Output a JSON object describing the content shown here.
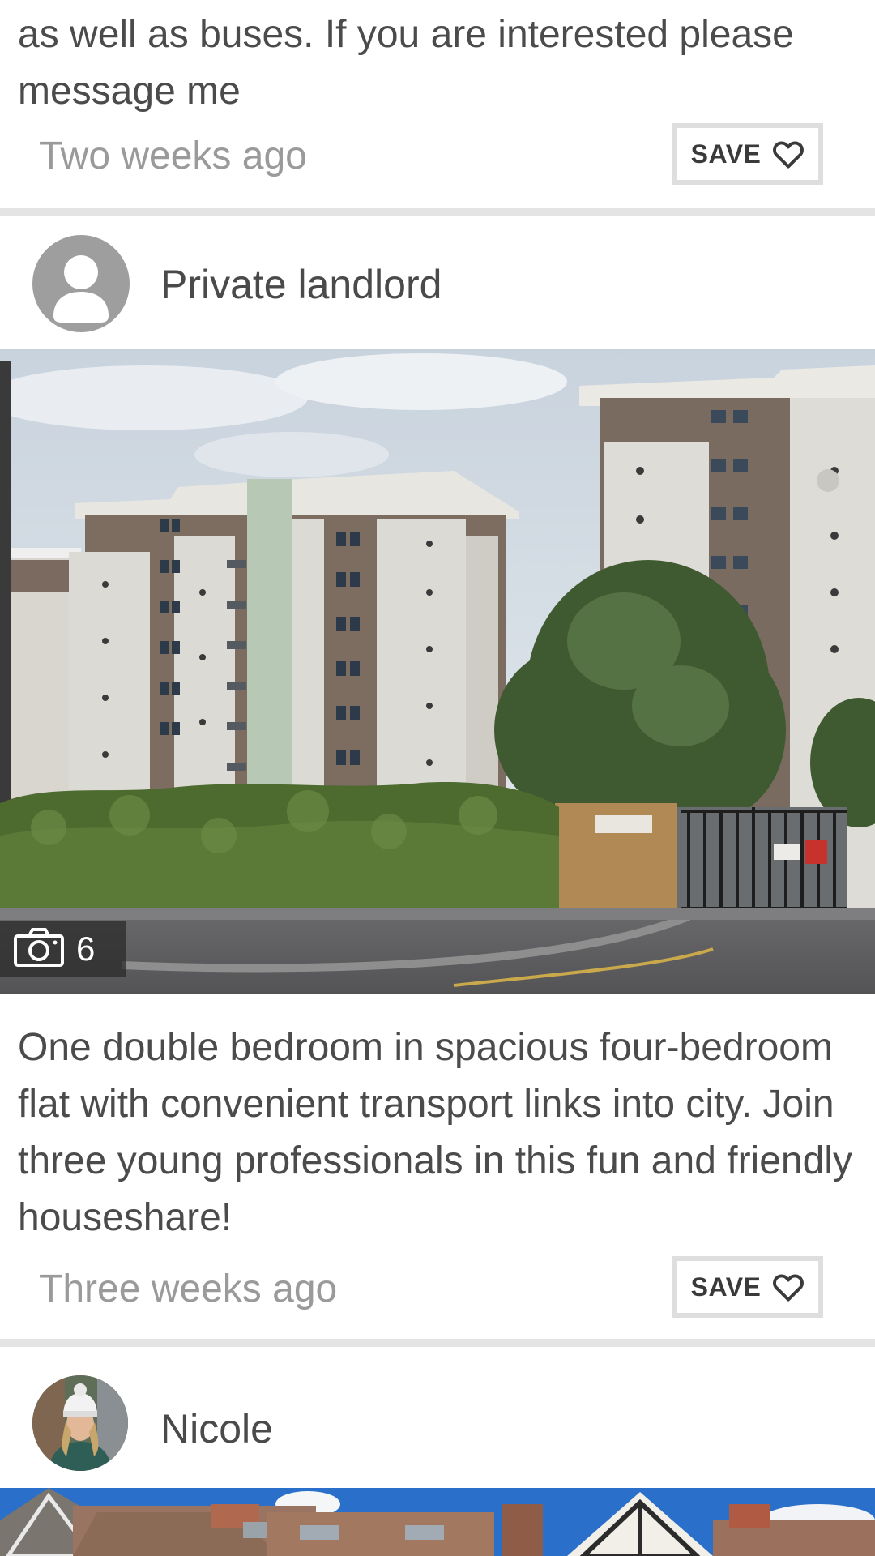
{
  "listing_prev": {
    "text": "as well as buses. If you are interested please message me",
    "time_ago": "Two weeks ago",
    "save_label": "SAVE"
  },
  "listing_main": {
    "poster_name": "Private landlord",
    "photo_count": "6",
    "description": "One double bedroom in spacious four-bedroom flat with convenient transport links into city. Join three young professionals in this fun and friendly houseshare!",
    "time_ago": "Three weeks ago",
    "save_label": "SAVE"
  },
  "listing_next": {
    "poster_name": "Nicole"
  },
  "icons": {
    "save": "heart-outline-icon",
    "photo_count": "camera-icon",
    "avatar_default": "person-icon"
  },
  "colors": {
    "divider": "#e4e4e4",
    "muted_text": "#9a9a9a",
    "body_text": "#4b4b4b",
    "save_border": "#dedede"
  }
}
